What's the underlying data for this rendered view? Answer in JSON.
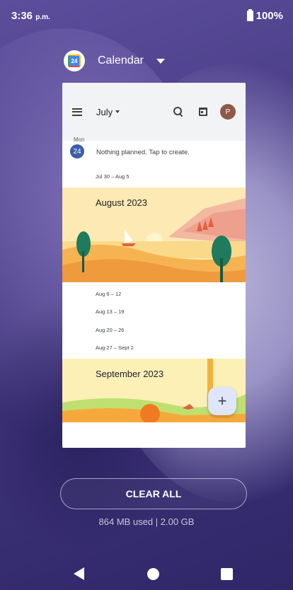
{
  "status_bar": {
    "time": "3:36",
    "time_suffix": "p.m.",
    "battery": "100%"
  },
  "app_header": {
    "name": "Calendar",
    "icon_label": "24"
  },
  "calendar": {
    "month_selector": "July",
    "avatar_letter": "P",
    "today": {
      "weekday": "Mon",
      "day": "24",
      "message": "Nothing planned. Tap to create."
    },
    "week_ranges_july": [
      "Jul 30 – Aug 5"
    ],
    "august_title": "August 2023",
    "week_ranges_august": [
      "Aug 6 – 12",
      "Aug 13 – 19",
      "Aug 20 – 26",
      "Aug 27 – Sept 2"
    ],
    "september_title": "September 2023",
    "fab_symbol": "+"
  },
  "recents": {
    "clear_all": "CLEAR ALL",
    "memory": "864 MB used | 2.00 GB"
  },
  "colors": {
    "accent_blue": "#3b5ea8",
    "avatar": "#8d5a4a",
    "fab": "#dfe5fb"
  }
}
